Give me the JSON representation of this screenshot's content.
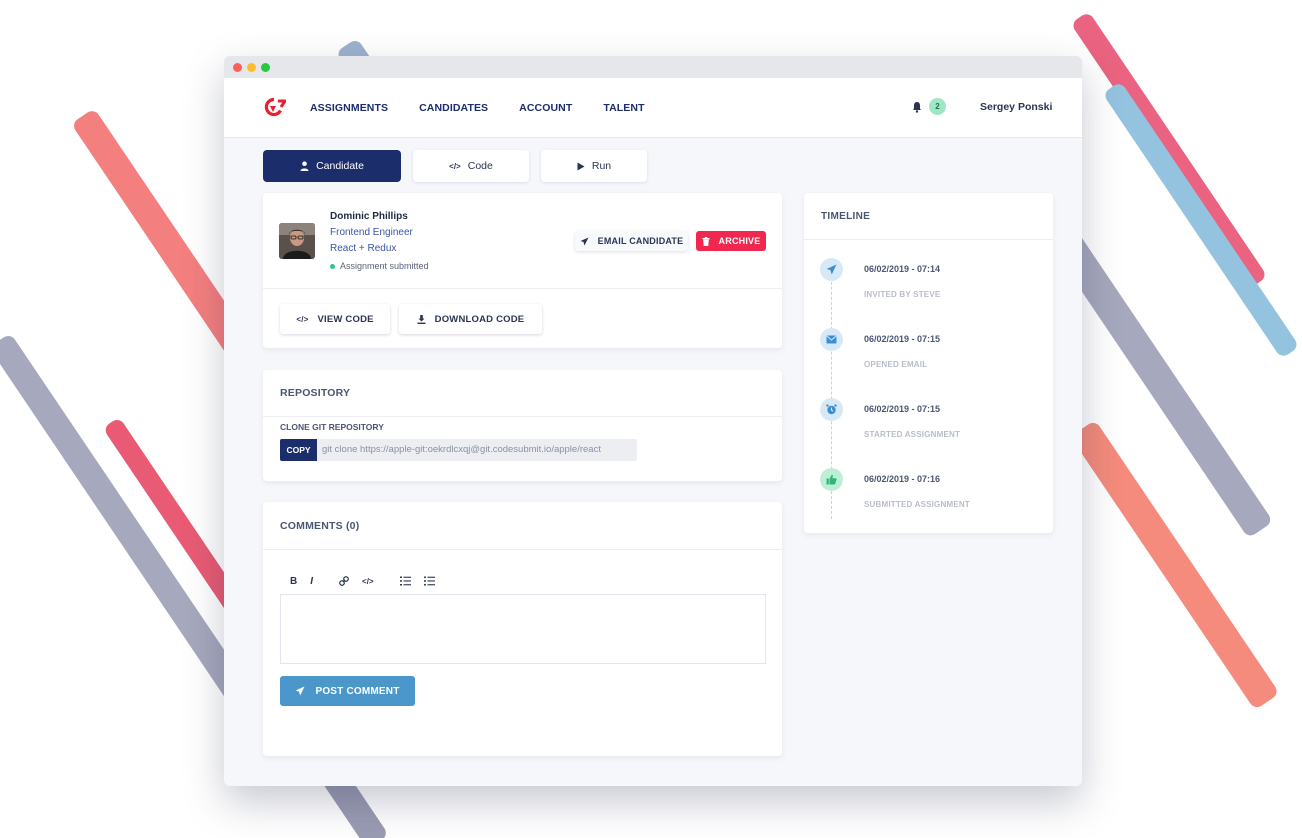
{
  "window": {
    "controls": [
      "close",
      "minimize",
      "maximize"
    ]
  },
  "nav": {
    "logo_icon": "brand-logo-icon",
    "links": [
      "ASSIGNMENTS",
      "CANDIDATES",
      "ACCOUNT",
      "TALENT"
    ],
    "notifications": {
      "icon": "bell-icon",
      "count": "2"
    },
    "user_name": "Sergey Ponski"
  },
  "tabs": [
    {
      "label": "Candidate",
      "icon": "user-icon",
      "active": true
    },
    {
      "label": "Code",
      "icon": "code-icon",
      "active": false
    },
    {
      "label": "Run",
      "icon": "play-icon",
      "active": false
    }
  ],
  "candidate": {
    "name": "Dominic Phillips",
    "title": "Frontend Engineer",
    "stack": "React + Redux",
    "status": "Assignment submitted",
    "email_button": "EMAIL CANDIDATE",
    "archive_button": "ARCHIVE",
    "view_code_button": "VIEW CODE",
    "download_code_button": "DOWNLOAD CODE"
  },
  "repository": {
    "title": "REPOSITORY",
    "clone_label": "CLONE GIT REPOSITORY",
    "copy_button": "COPY",
    "clone_command": "git clone https://apple-git:oekrdlcxqj@git.codesubmit.io/apple/react"
  },
  "comments": {
    "title": "COMMENTS (0)",
    "toolbar": {
      "bold": "B",
      "italic": "I",
      "link": "link-icon",
      "code": "code-icon",
      "ordered_list": "ordered-list-icon",
      "bullet_list": "bullet-list-icon"
    },
    "post_button": "POST COMMENT"
  },
  "timeline": {
    "title": "TIMELINE",
    "events": [
      {
        "date": "06/02/2019 - 07:14",
        "label": "INVITED BY STEVE",
        "icon": "send-icon"
      },
      {
        "date": "06/02/2019 - 07:15",
        "label": "OPENED EMAIL",
        "icon": "envelope-icon"
      },
      {
        "date": "06/02/2019 - 07:15",
        "label": "STARTED ASSIGNMENT",
        "icon": "alarm-clock-icon"
      },
      {
        "date": "06/02/2019 - 07:16",
        "label": "SUBMITTED ASSIGNMENT",
        "icon": "thumbs-up-icon"
      }
    ]
  },
  "colors": {
    "brand_navy": "#1c2d6b",
    "danger_red": "#f0284f",
    "action_blue": "#4b97cb",
    "success_green": "#30c58a",
    "logo_red": "#e8202f"
  }
}
